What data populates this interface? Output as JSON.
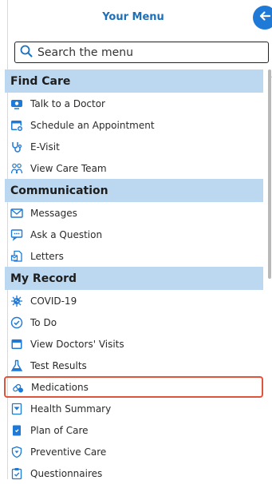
{
  "header": {
    "title": "Your Menu",
    "back_icon": "arrow-left-icon"
  },
  "search": {
    "placeholder": "Search the menu",
    "icon": "search-icon"
  },
  "sections": [
    {
      "title": "Find Care",
      "items": [
        {
          "label": "Talk to a Doctor",
          "icon": "video-chat-icon"
        },
        {
          "label": "Schedule an Appointment",
          "icon": "calendar-add-icon"
        },
        {
          "label": "E-Visit",
          "icon": "stethoscope-icon"
        },
        {
          "label": "View Care Team",
          "icon": "care-team-icon"
        }
      ]
    },
    {
      "title": "Communication",
      "items": [
        {
          "label": "Messages",
          "icon": "envelope-icon"
        },
        {
          "label": "Ask a Question",
          "icon": "chat-bubble-icon"
        },
        {
          "label": "Letters",
          "icon": "letter-icon"
        }
      ]
    },
    {
      "title": "My Record",
      "items": [
        {
          "label": "COVID-19",
          "icon": "virus-icon"
        },
        {
          "label": "To Do",
          "icon": "checkmark-circle-icon"
        },
        {
          "label": "View Doctors' Visits",
          "icon": "calendar-icon"
        },
        {
          "label": "Test Results",
          "icon": "flask-icon"
        },
        {
          "label": "Medications",
          "icon": "pills-icon",
          "highlighted": true
        },
        {
          "label": "Health Summary",
          "icon": "health-summary-icon"
        },
        {
          "label": "Plan of Care",
          "icon": "plan-of-care-icon"
        },
        {
          "label": "Preventive Care",
          "icon": "shield-icon"
        },
        {
          "label": "Questionnaires",
          "icon": "clipboard-check-icon"
        }
      ]
    }
  ],
  "colors": {
    "accent": "#1e7ad6",
    "section_header_bg": "#bcd8f0",
    "highlight_border": "#e0533d",
    "title_color": "#1f6fb8"
  }
}
